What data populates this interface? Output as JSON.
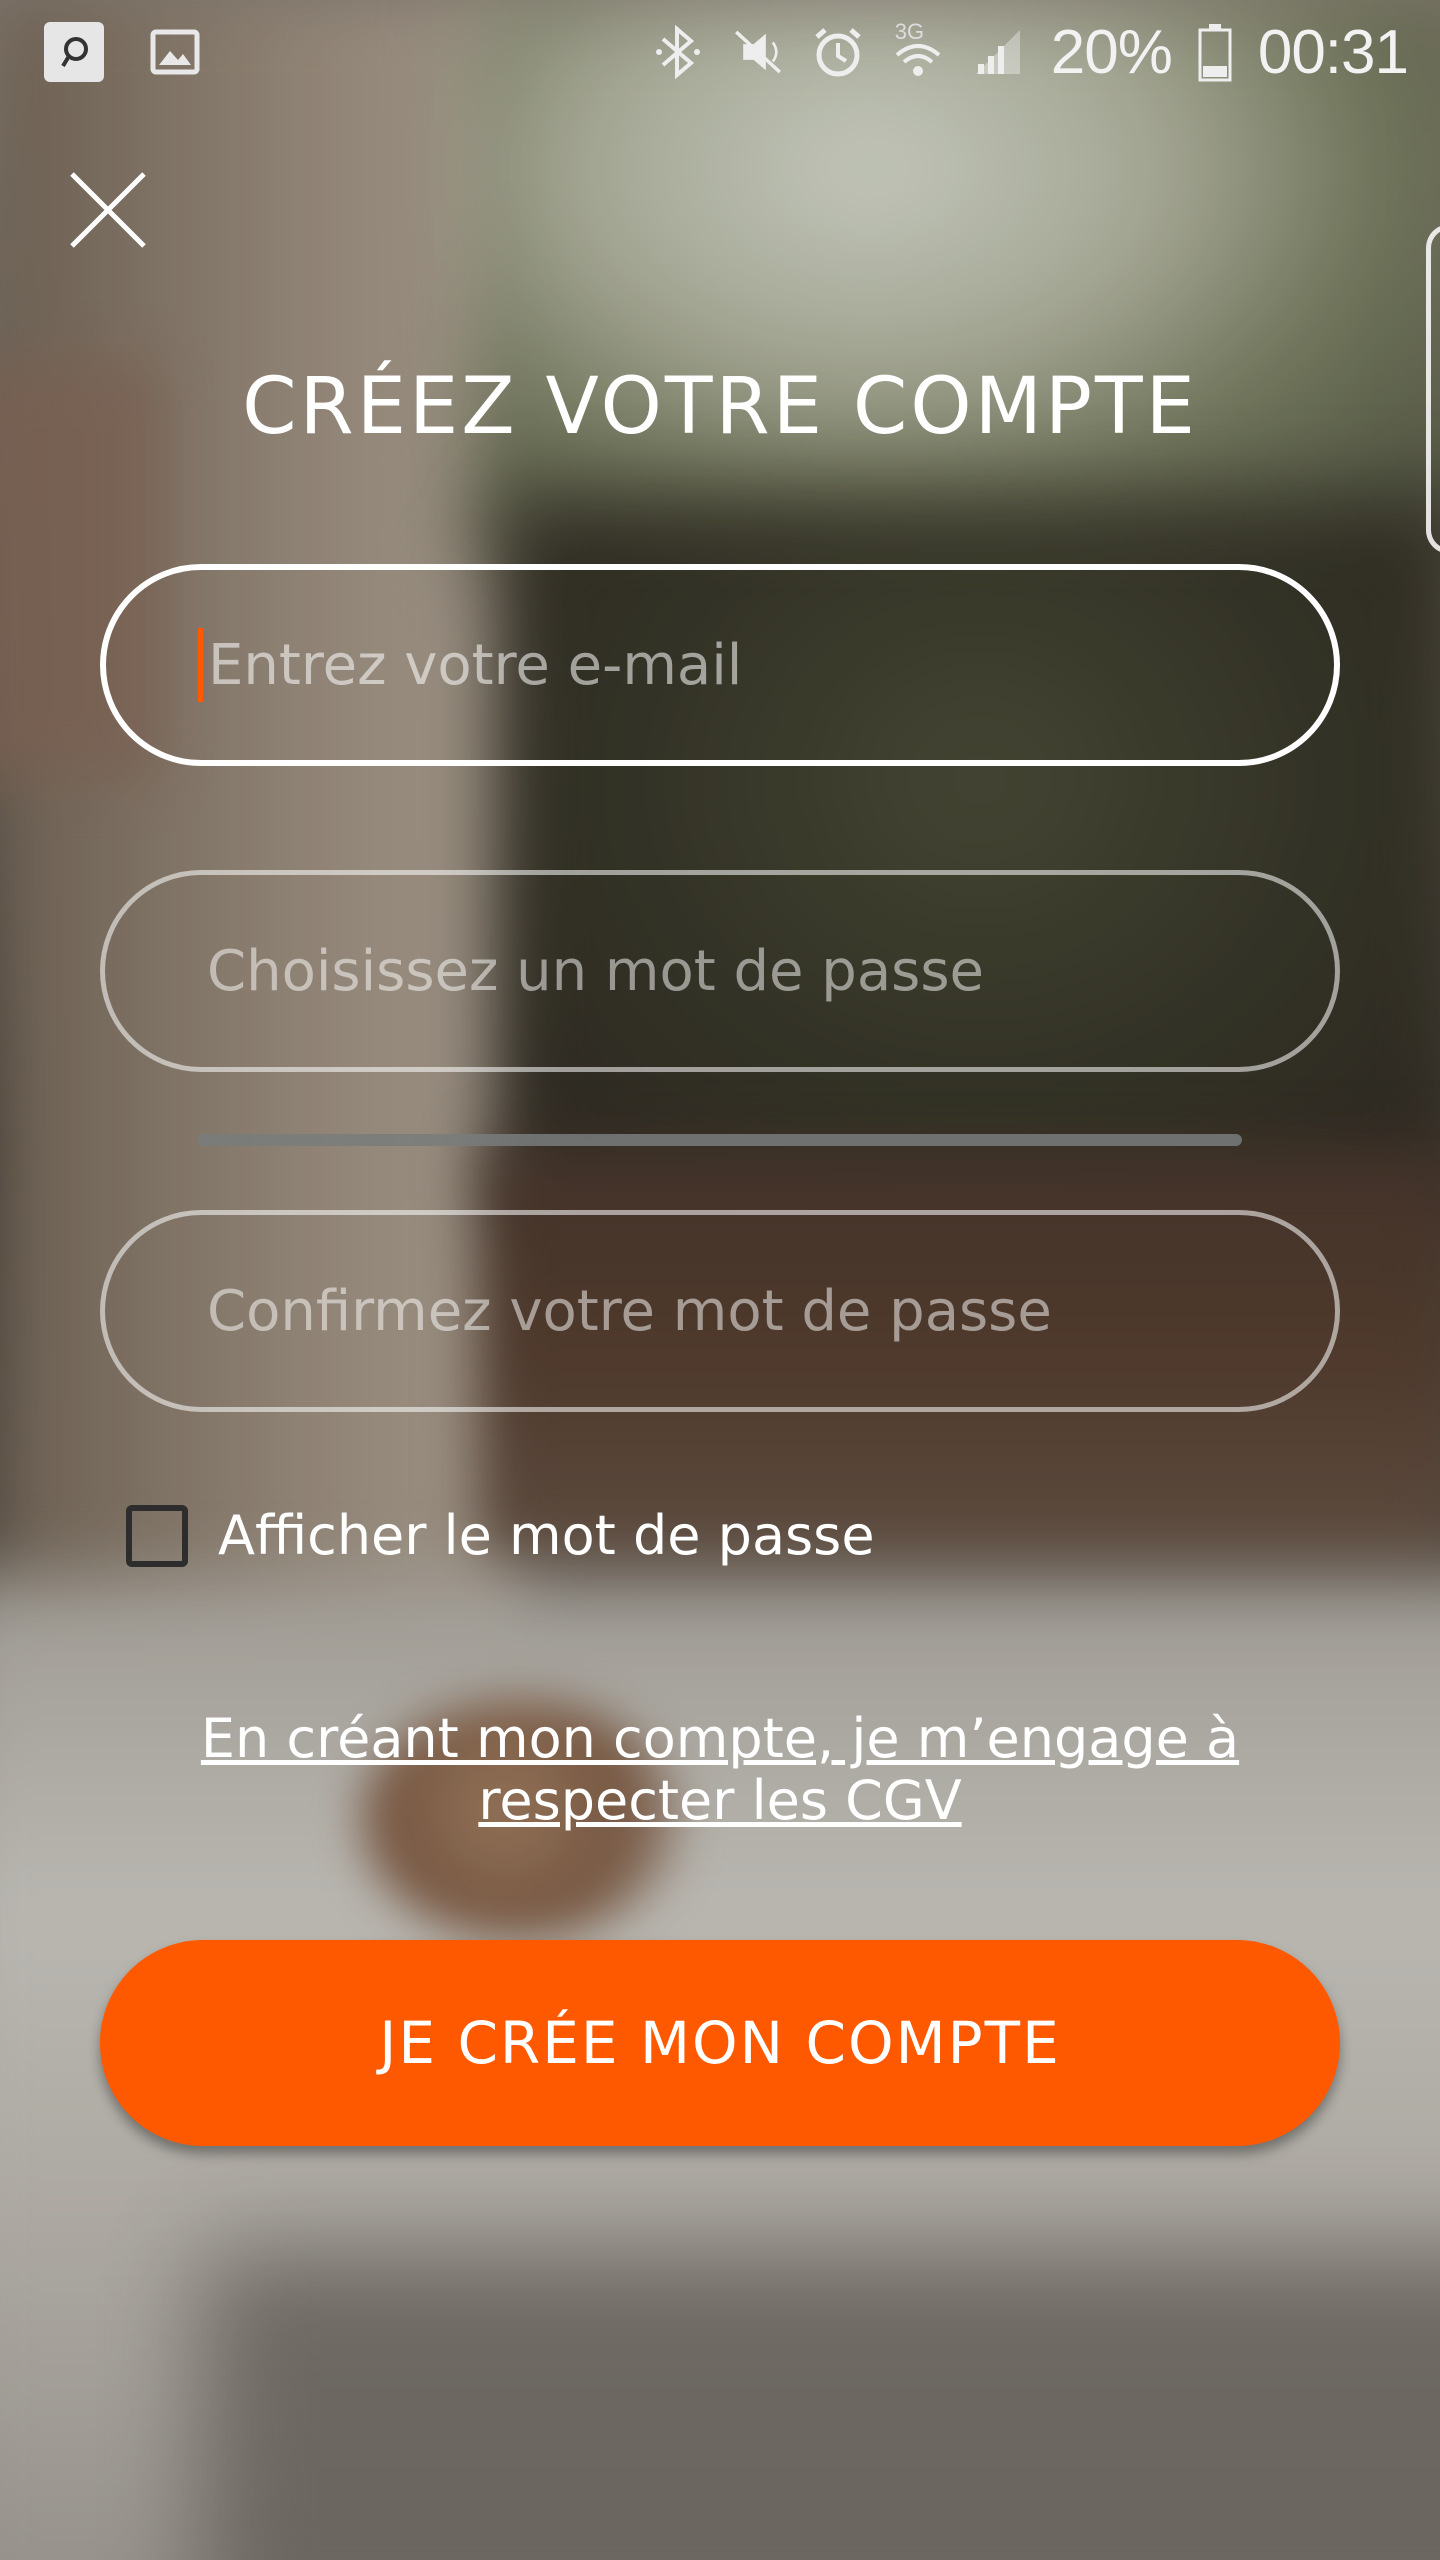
{
  "status_bar": {
    "battery": "20%",
    "time": "00:31",
    "network": "3G",
    "icons": [
      "app-notification-icon",
      "image-notification-icon",
      "bluetooth-icon",
      "mute-icon",
      "alarm-icon",
      "wifi-icon",
      "signal-icon",
      "battery-icon"
    ]
  },
  "page": {
    "title": "CRÉEZ VOTRE COMPTE",
    "email_placeholder": "Entrez votre e-mail",
    "password_placeholder": "Choisissez un mot de passe",
    "confirm_placeholder": "Confirmez votre mot de passe",
    "show_password_label": "Afficher le mot de passe",
    "terms_text": "En créant mon compte, je m’engage à respecter les CGV",
    "submit_label": "JE CRÉE MON COMPTE",
    "password_strength": 0
  },
  "colors": {
    "accent": "#ff5900",
    "text": "#ffffff"
  }
}
